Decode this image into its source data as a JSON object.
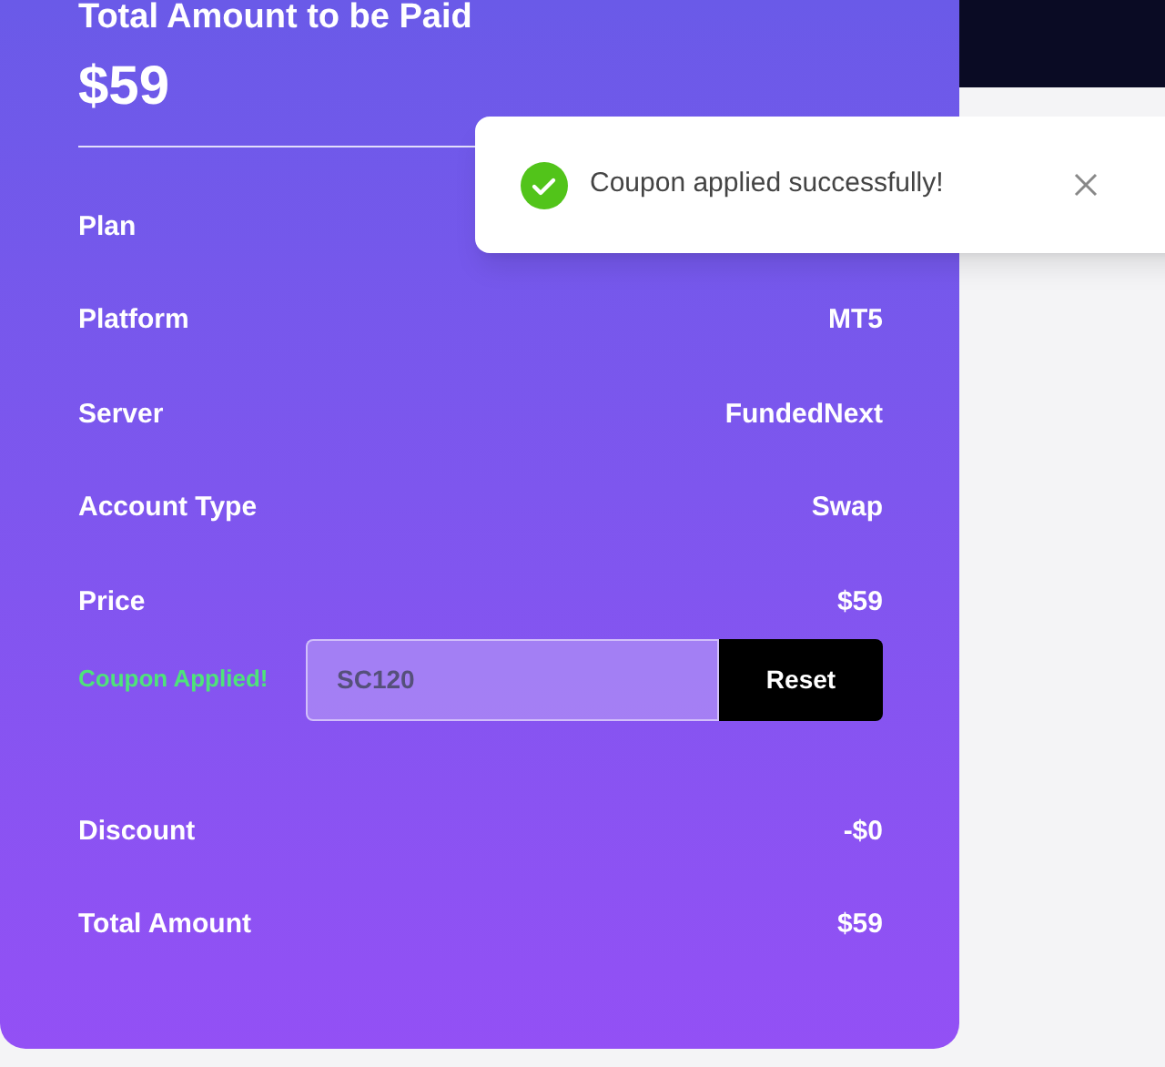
{
  "summary": {
    "title": "Total Amount to be Paid",
    "amount": "$59",
    "rows": [
      {
        "label": "Plan"
      },
      {
        "label": "Platform",
        "value": "MT5"
      },
      {
        "label": "Server",
        "value": "FundedNext"
      },
      {
        "label": "Account Type",
        "value": "Swap"
      },
      {
        "label": "Price",
        "value": "$59"
      }
    ],
    "coupon": {
      "status": "Coupon Applied!",
      "value": "SC120",
      "button": "Reset"
    },
    "totals": [
      {
        "label": "Discount",
        "value": "-$0"
      },
      {
        "label": "Total Amount",
        "value": "$59"
      }
    ]
  },
  "toast": {
    "message": "Coupon applied successfully!"
  }
}
